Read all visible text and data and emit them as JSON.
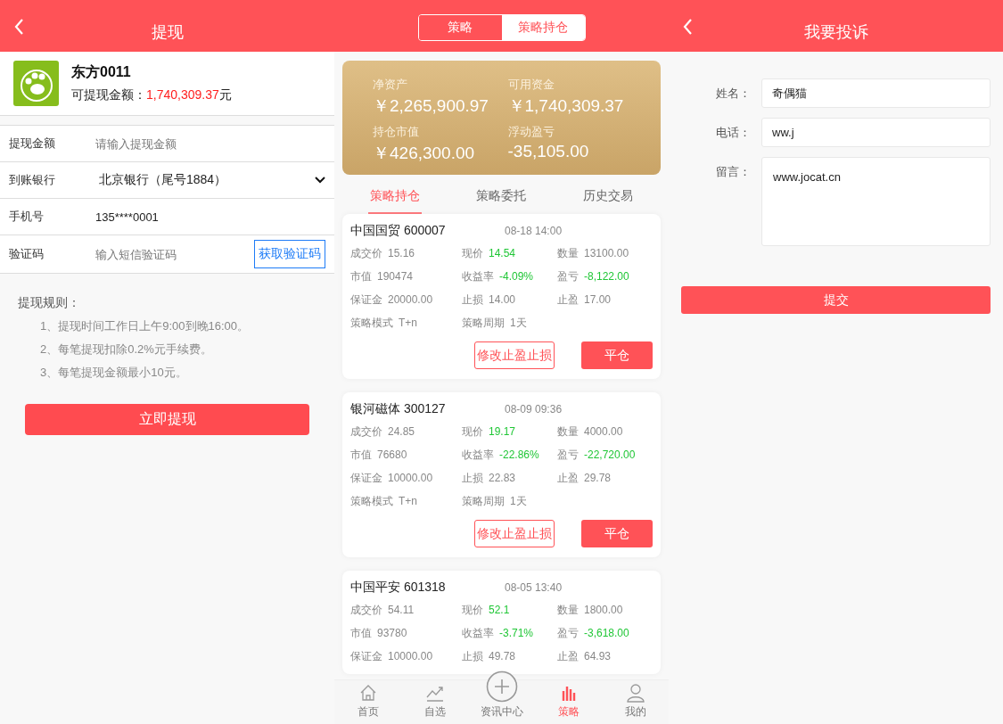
{
  "withdraw": {
    "header": {
      "title": "提现"
    },
    "profile": {
      "name": "东方0011",
      "balance_label": "可提现金额：",
      "balance_amount": "1,740,309.37",
      "balance_unit": "元"
    },
    "rows": [
      {
        "kind": "input",
        "label": "提现金额",
        "placeholder": "请输入提现金额"
      },
      {
        "kind": "select",
        "label": "到账银行",
        "value": "北京银行（尾号1884）"
      },
      {
        "kind": "text",
        "label": "手机号",
        "value": "135****0001"
      },
      {
        "kind": "code",
        "label": "验证码",
        "placeholder": "输入短信验证码",
        "button": "获取验证码"
      }
    ],
    "rules": {
      "title": "提现规则：",
      "items": [
        "1、提现时间工作日上午9:00到晚16:00。",
        "2、每笔提现扣除0.2%元手续费。",
        "3、每笔提现金额最小10元。"
      ]
    },
    "submit": "立即提现"
  },
  "strategy": {
    "segments": [
      {
        "label": "策略",
        "selected": true
      },
      {
        "label": "策略持仓",
        "selected": false
      }
    ],
    "summary": [
      {
        "label": "净资产",
        "value": "￥2,265,900.97"
      },
      {
        "label": "可用资金",
        "value": "￥1,740,309.37"
      },
      {
        "label": "持仓市值",
        "value": "￥426,300.00"
      },
      {
        "label": "浮动盈亏",
        "value": "-35,105.00"
      }
    ],
    "tabs": [
      {
        "label": "策略持仓",
        "selected": true
      },
      {
        "label": "策略委托",
        "selected": false
      },
      {
        "label": "历史交易",
        "selected": false
      }
    ],
    "positions": [
      {
        "name": "中国国贸 600007",
        "time": "08-18 14:00",
        "fields": [
          {
            "label": "成交价",
            "value": "15.16",
            "loss": false
          },
          {
            "label": "现价",
            "value": "14.54",
            "loss": true
          },
          {
            "label": "数量",
            "value": "13100.00",
            "loss": false
          },
          {
            "label": "市值",
            "value": "190474",
            "loss": false
          },
          {
            "label": "收益率",
            "value": "-4.09%",
            "loss": true
          },
          {
            "label": "盈亏",
            "value": "-8,122.00",
            "loss": true
          },
          {
            "label": "保证金",
            "value": "20000.00",
            "loss": false
          },
          {
            "label": "止损",
            "value": "14.00",
            "loss": false
          },
          {
            "label": "止盈",
            "value": "17.00",
            "loss": false
          },
          {
            "label": "策略模式",
            "value": "T+n",
            "loss": false
          },
          {
            "label": "策略周期",
            "value": "1天",
            "loss": false
          }
        ],
        "buttons": [
          "修改止盈止损",
          "平仓"
        ]
      },
      {
        "name": "银河磁体 300127",
        "time": "08-09 09:36",
        "fields": [
          {
            "label": "成交价",
            "value": "24.85",
            "loss": false
          },
          {
            "label": "现价",
            "value": "19.17",
            "loss": true
          },
          {
            "label": "数量",
            "value": "4000.00",
            "loss": false
          },
          {
            "label": "市值",
            "value": "76680",
            "loss": false
          },
          {
            "label": "收益率",
            "value": "-22.86%",
            "loss": true
          },
          {
            "label": "盈亏",
            "value": "-22,720.00",
            "loss": true
          },
          {
            "label": "保证金",
            "value": "10000.00",
            "loss": false
          },
          {
            "label": "止损",
            "value": "22.83",
            "loss": false
          },
          {
            "label": "止盈",
            "value": "29.78",
            "loss": false
          },
          {
            "label": "策略模式",
            "value": "T+n",
            "loss": false
          },
          {
            "label": "策略周期",
            "value": "1天",
            "loss": false
          }
        ],
        "buttons": [
          "修改止盈止损",
          "平仓"
        ]
      },
      {
        "name": "中国平安 601318",
        "time": "08-05 13:40",
        "fields": [
          {
            "label": "成交价",
            "value": "54.11",
            "loss": false
          },
          {
            "label": "现价",
            "value": "52.1",
            "loss": true
          },
          {
            "label": "数量",
            "value": "1800.00",
            "loss": false
          },
          {
            "label": "市值",
            "value": "93780",
            "loss": false
          },
          {
            "label": "收益率",
            "value": "-3.71%",
            "loss": true
          },
          {
            "label": "盈亏",
            "value": "-3,618.00",
            "loss": true
          },
          {
            "label": "保证金",
            "value": "10000.00",
            "loss": false
          },
          {
            "label": "止损",
            "value": "49.78",
            "loss": false
          },
          {
            "label": "止盈",
            "value": "64.93",
            "loss": false
          }
        ]
      }
    ],
    "nav": [
      {
        "kind": "home",
        "label": "首页",
        "selected": false
      },
      {
        "kind": "chart",
        "label": "自选",
        "selected": false
      },
      {
        "kind": "plus",
        "label": "资讯中心",
        "selected": false
      },
      {
        "kind": "bars",
        "label": "策略",
        "selected": true
      },
      {
        "kind": "user",
        "label": "我的",
        "selected": false
      }
    ]
  },
  "complaint": {
    "header": {
      "title": "我要投诉"
    },
    "fields": [
      {
        "kind": "input",
        "label": "姓名：",
        "value": "奇偶猫"
      },
      {
        "kind": "input",
        "label": "电话：",
        "value": "ww.j"
      },
      {
        "kind": "textarea",
        "label": "留言：",
        "value": "www.jocat.cn"
      }
    ],
    "submit": "提交"
  }
}
